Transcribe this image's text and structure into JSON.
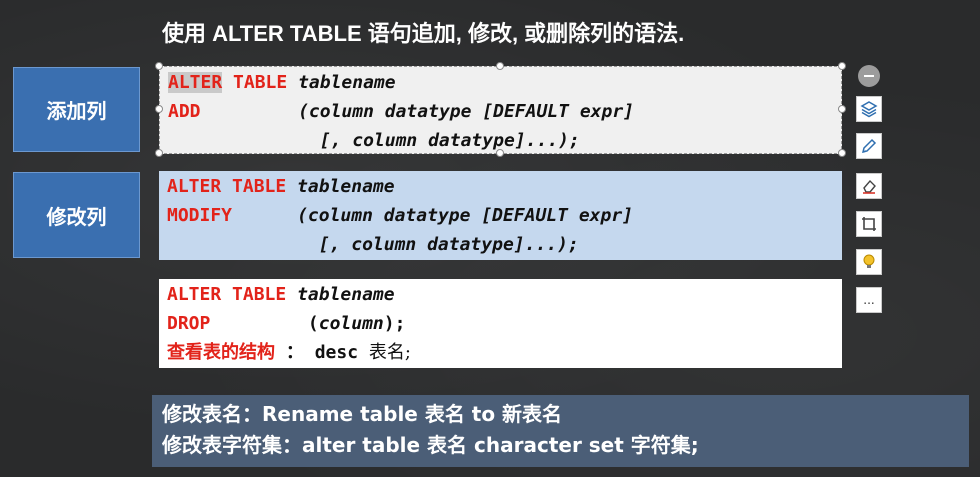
{
  "title": "使用 ALTER TABLE 语句追加, 修改, 或删除列的语法.",
  "tags": {
    "add": "添加列",
    "modify": "修改列"
  },
  "add_block": {
    "kw_alter": "ALTER",
    "kw_table": "TABLE",
    "tablename": "tablename",
    "kw_add": "ADD",
    "line2_rest": "(column datatype [DEFAULT expr]",
    "line3": "[, column datatype]...);"
  },
  "modify_block": {
    "kw_alter_table": "ALTER TABLE",
    "tablename": "tablename",
    "kw_modify": "MODIFY",
    "line2_rest": "(column datatype [DEFAULT expr]",
    "line3": "[, column datatype]...);"
  },
  "drop_block": {
    "kw_alter_table": "ALTER TABLE",
    "tablename": "tablename",
    "kw_drop": "DROP",
    "column_open": "(",
    "column": "column",
    "column_close": ");",
    "view_label": "查看表的结构",
    "colon": "：",
    "desc": "desc",
    "desc_arg": "表名;"
  },
  "footer": {
    "line1": "修改表名：Rename table 表名 to 新表名",
    "line2": "修改表字符集：alter table 表名 character set 字符集;"
  },
  "toolbar": {
    "more_label": "..."
  },
  "colors": {
    "keyword": "#e2231a",
    "tag_bg": "#3a6fb0",
    "modify_bg": "#c5d8ee",
    "footer_bg": "#4b5e77"
  },
  "icons": [
    "minus-icon",
    "layers-icon",
    "pen-icon",
    "eraser-icon",
    "crop-icon",
    "lightbulb-icon",
    "more-icon"
  ]
}
